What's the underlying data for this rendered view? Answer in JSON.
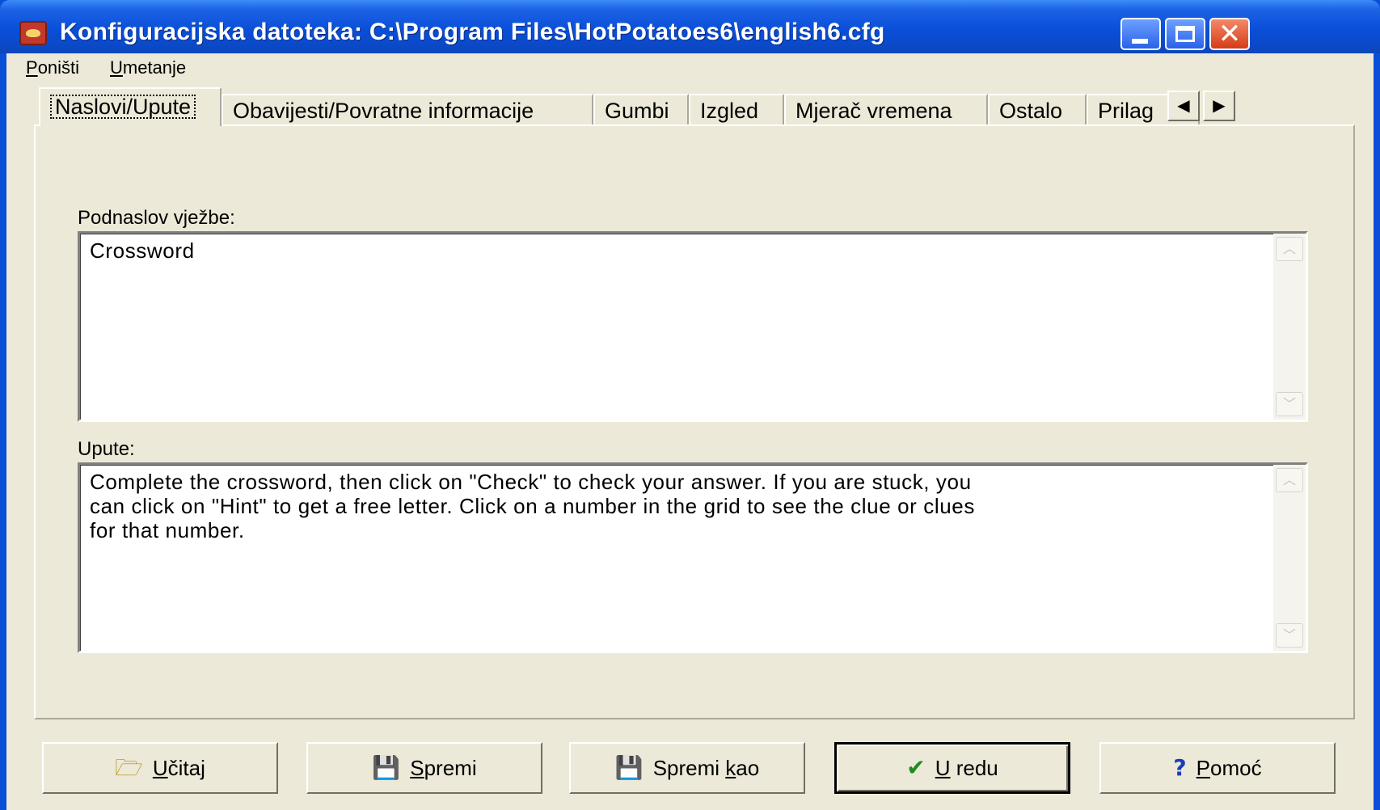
{
  "window": {
    "title": "Konfiguracijska datoteka: C:\\Program Files\\HotPotatoes6\\english6.cfg",
    "close_glyph": "✕"
  },
  "menu": {
    "undo": {
      "acc": "P",
      "rest": "oništi"
    },
    "insert": {
      "acc": "U",
      "rest": "metanje"
    }
  },
  "tabs": [
    "Naslovi/Upute",
    "Obavijesti/Povratne informacije",
    "Gumbi",
    "Izgled",
    "Mjerač vremena",
    "Ostalo",
    "Prilag"
  ],
  "tab_scroll": {
    "left": "◀",
    "right": "▶"
  },
  "subtitle": {
    "label": "Podnaslov vježbe:",
    "value": "Crossword"
  },
  "instructions": {
    "label": "Upute:",
    "value": "Complete the crossword, then click on \"Check\" to check your answer. If you are stuck, you\ncan click on \"Hint\" to get a free letter. Click on a number in the grid to see the clue or clues\nfor that number."
  },
  "scroll_glyphs": {
    "up": "︿",
    "down": "﹀"
  },
  "buttons": {
    "load": {
      "icon": "🗁",
      "acc": "U",
      "rest": "čitaj"
    },
    "save": {
      "icon": "💾",
      "acc": "S",
      "rest": "premi"
    },
    "save_as": {
      "icon": "💾",
      "pre": "Spremi ",
      "acc": "k",
      "rest": "ao"
    },
    "ok": {
      "icon": "✔",
      "acc": "U",
      "rest": " redu"
    },
    "help": {
      "icon": "?",
      "acc": "P",
      "rest": "omoć"
    }
  },
  "colors": {
    "titlebar": "#0a4fd8",
    "face": "#ece9d8",
    "close_button": "#d63b16"
  },
  "icons": {
    "app": "hot-potato-icon",
    "minimize": "minimize-icon",
    "maximize": "maximize-icon",
    "close": "close-icon"
  }
}
